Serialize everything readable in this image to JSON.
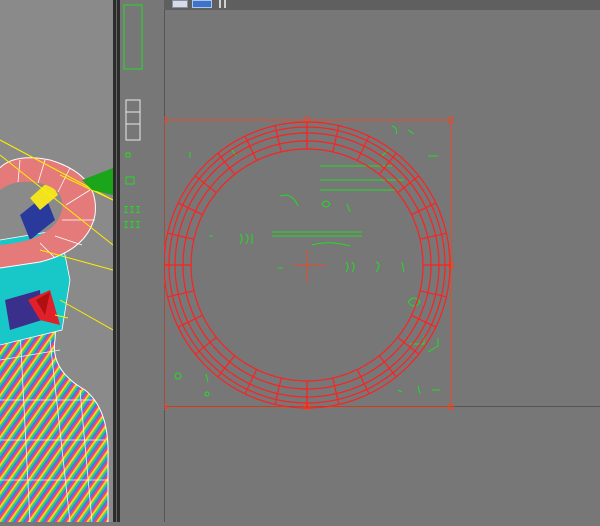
{
  "toolbar": {
    "tools": [
      {
        "icon": "down-arrow-icon"
      },
      {
        "icon": "circle-icon"
      },
      {
        "icon": "grid-view-icon"
      },
      {
        "icon": "active-view-icon"
      },
      {
        "icon": "bars-icon"
      }
    ]
  },
  "viewports": {
    "left": {
      "icon": "perspective-wireframe"
    },
    "main": {
      "selection": "torus-ring"
    }
  },
  "colors": {
    "background": "#777777",
    "wireframe_green": "#22dd22",
    "selection_red": "#ff2020",
    "splitter": "#2c2c2c"
  }
}
